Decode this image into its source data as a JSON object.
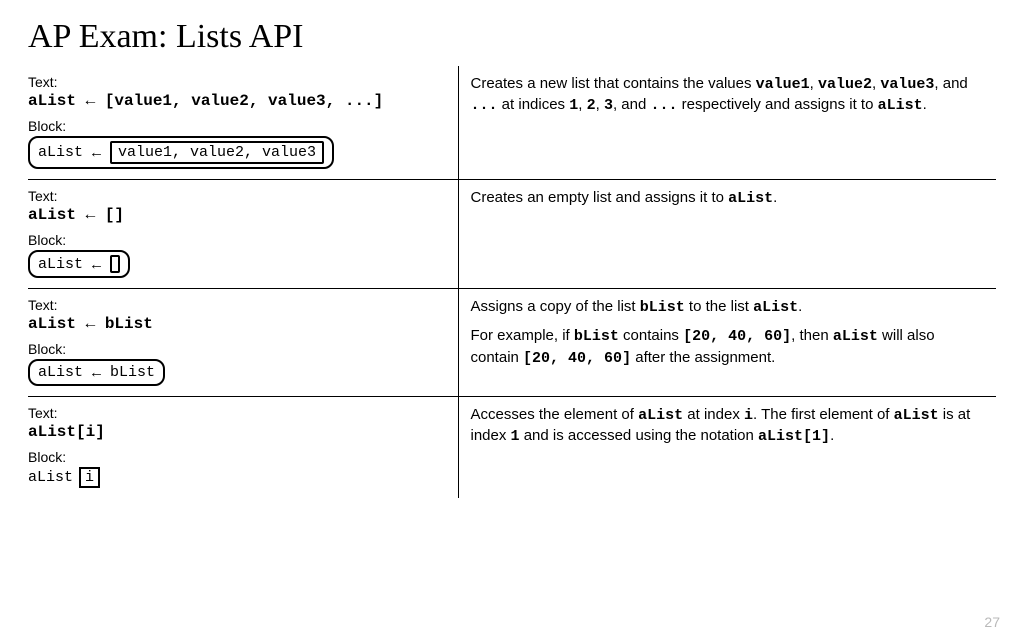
{
  "title": "AP Exam: Lists API",
  "pageNumber": "27",
  "labels": {
    "text": "Text:",
    "block": "Block:"
  },
  "rows": [
    {
      "text_code": "aList ← [value1, value2, value3, ...]",
      "block": {
        "left": "aList",
        "box": "value1, value2, value3",
        "empty": false,
        "hasBox": true,
        "rounded": true
      },
      "desc": {
        "parts": [
          {
            "t": "Creates a new list that contains the values "
          },
          {
            "m": "value1"
          },
          {
            "t": ", "
          },
          {
            "m": "value2"
          },
          {
            "t": ", "
          },
          {
            "m": "value3"
          },
          {
            "t": ", and "
          },
          {
            "m": "..."
          },
          {
            "t": " at indices "
          },
          {
            "m": "1"
          },
          {
            "t": ", "
          },
          {
            "m": "2"
          },
          {
            "t": ", "
          },
          {
            "m": "3"
          },
          {
            "t": ", and "
          },
          {
            "m": "..."
          },
          {
            "t": " respectively and assigns it to "
          },
          {
            "m": "aList"
          },
          {
            "t": "."
          }
        ]
      }
    },
    {
      "text_code": "aList ← []",
      "block": {
        "left": "aList",
        "box": "",
        "empty": true,
        "hasBox": true,
        "rounded": true
      },
      "desc": {
        "parts": [
          {
            "t": "Creates an empty list and assigns it to "
          },
          {
            "m": "aList"
          },
          {
            "t": "."
          }
        ]
      }
    },
    {
      "text_code": "aList ← bList",
      "block": {
        "left": "aList",
        "right": "bList",
        "hasBox": false,
        "rounded": true
      },
      "desc": {
        "paragraphs": [
          [
            {
              "t": "Assigns a copy of the list "
            },
            {
              "m": "bList"
            },
            {
              "t": " to the list "
            },
            {
              "m": "aList"
            },
            {
              "t": "."
            }
          ],
          [
            {
              "t": "For example, if "
            },
            {
              "m": "bList"
            },
            {
              "t": " contains "
            },
            {
              "m": "[20, 40, 60]"
            },
            {
              "t": ", then "
            },
            {
              "m": "aList"
            },
            {
              "t": " will also contain "
            },
            {
              "m": "[20, 40, 60]"
            },
            {
              "t": " after the assignment."
            }
          ]
        ]
      }
    },
    {
      "text_code": "aList[i]",
      "block": {
        "plain": true,
        "left": "aList",
        "boxed": "i"
      },
      "desc": {
        "parts": [
          {
            "t": "Accesses the element of "
          },
          {
            "m": "aList"
          },
          {
            "t": " at index "
          },
          {
            "m": "i"
          },
          {
            "t": ". The first element of "
          },
          {
            "m": "aList"
          },
          {
            "t": " is at index "
          },
          {
            "m": "1"
          },
          {
            "t": " and is accessed using the notation "
          },
          {
            "m": "aList[1]"
          },
          {
            "t": "."
          }
        ]
      }
    }
  ]
}
